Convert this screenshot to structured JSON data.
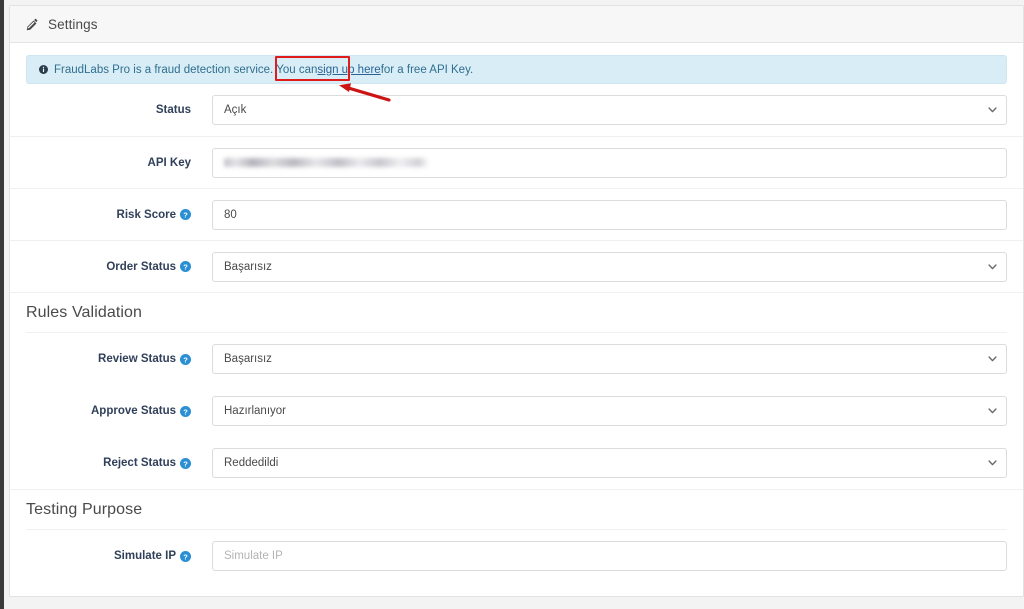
{
  "panel": {
    "title": "Settings",
    "icon": "pencil-icon"
  },
  "alert": {
    "icon": "info-circle-icon",
    "text_before": "FraudLabs Pro is a fraud detection service. You can ",
    "link_text": "sign up here",
    "text_after": " for a free API Key."
  },
  "sections": [
    {
      "heading": null,
      "rows": [
        {
          "label": "Status",
          "help": false,
          "type": "select",
          "value": "Açık",
          "placeholder": "",
          "name": "status"
        },
        {
          "label": "API Key",
          "help": false,
          "type": "text",
          "value": "",
          "redacted": true,
          "placeholder": "",
          "name": "api-key"
        },
        {
          "label": "Risk Score",
          "help": true,
          "type": "text",
          "value": "80",
          "placeholder": "",
          "name": "risk-score"
        },
        {
          "label": "Order Status",
          "help": true,
          "type": "select",
          "value": "Başarısız",
          "placeholder": "",
          "name": "order-status"
        }
      ]
    },
    {
      "heading": "Rules Validation",
      "rows": [
        {
          "label": "Review Status",
          "help": true,
          "type": "select",
          "value": "Başarısız",
          "placeholder": "",
          "name": "review-status"
        },
        {
          "label": "Approve Status",
          "help": true,
          "type": "select",
          "value": "Hazırlanıyor",
          "placeholder": "",
          "name": "approve-status"
        },
        {
          "label": "Reject Status",
          "help": true,
          "type": "select",
          "value": "Reddedildi",
          "placeholder": "",
          "name": "reject-status"
        }
      ]
    },
    {
      "heading": "Testing Purpose",
      "rows": [
        {
          "label": "Simulate IP",
          "help": true,
          "type": "text",
          "value": "",
          "placeholder": "Simulate IP",
          "name": "simulate-ip"
        }
      ]
    }
  ],
  "annotations": {
    "highlight_color": "#e01b1b",
    "highlight_target": "sign up here",
    "arrow_color": "#cc1414"
  },
  "colors": {
    "alert_bg": "#d9edf7",
    "alert_text": "#31708f",
    "link": "#2a6496",
    "help_icon": "#2a8fd4",
    "label_text": "#31405a",
    "panel_bg": "#f7f7f7"
  }
}
